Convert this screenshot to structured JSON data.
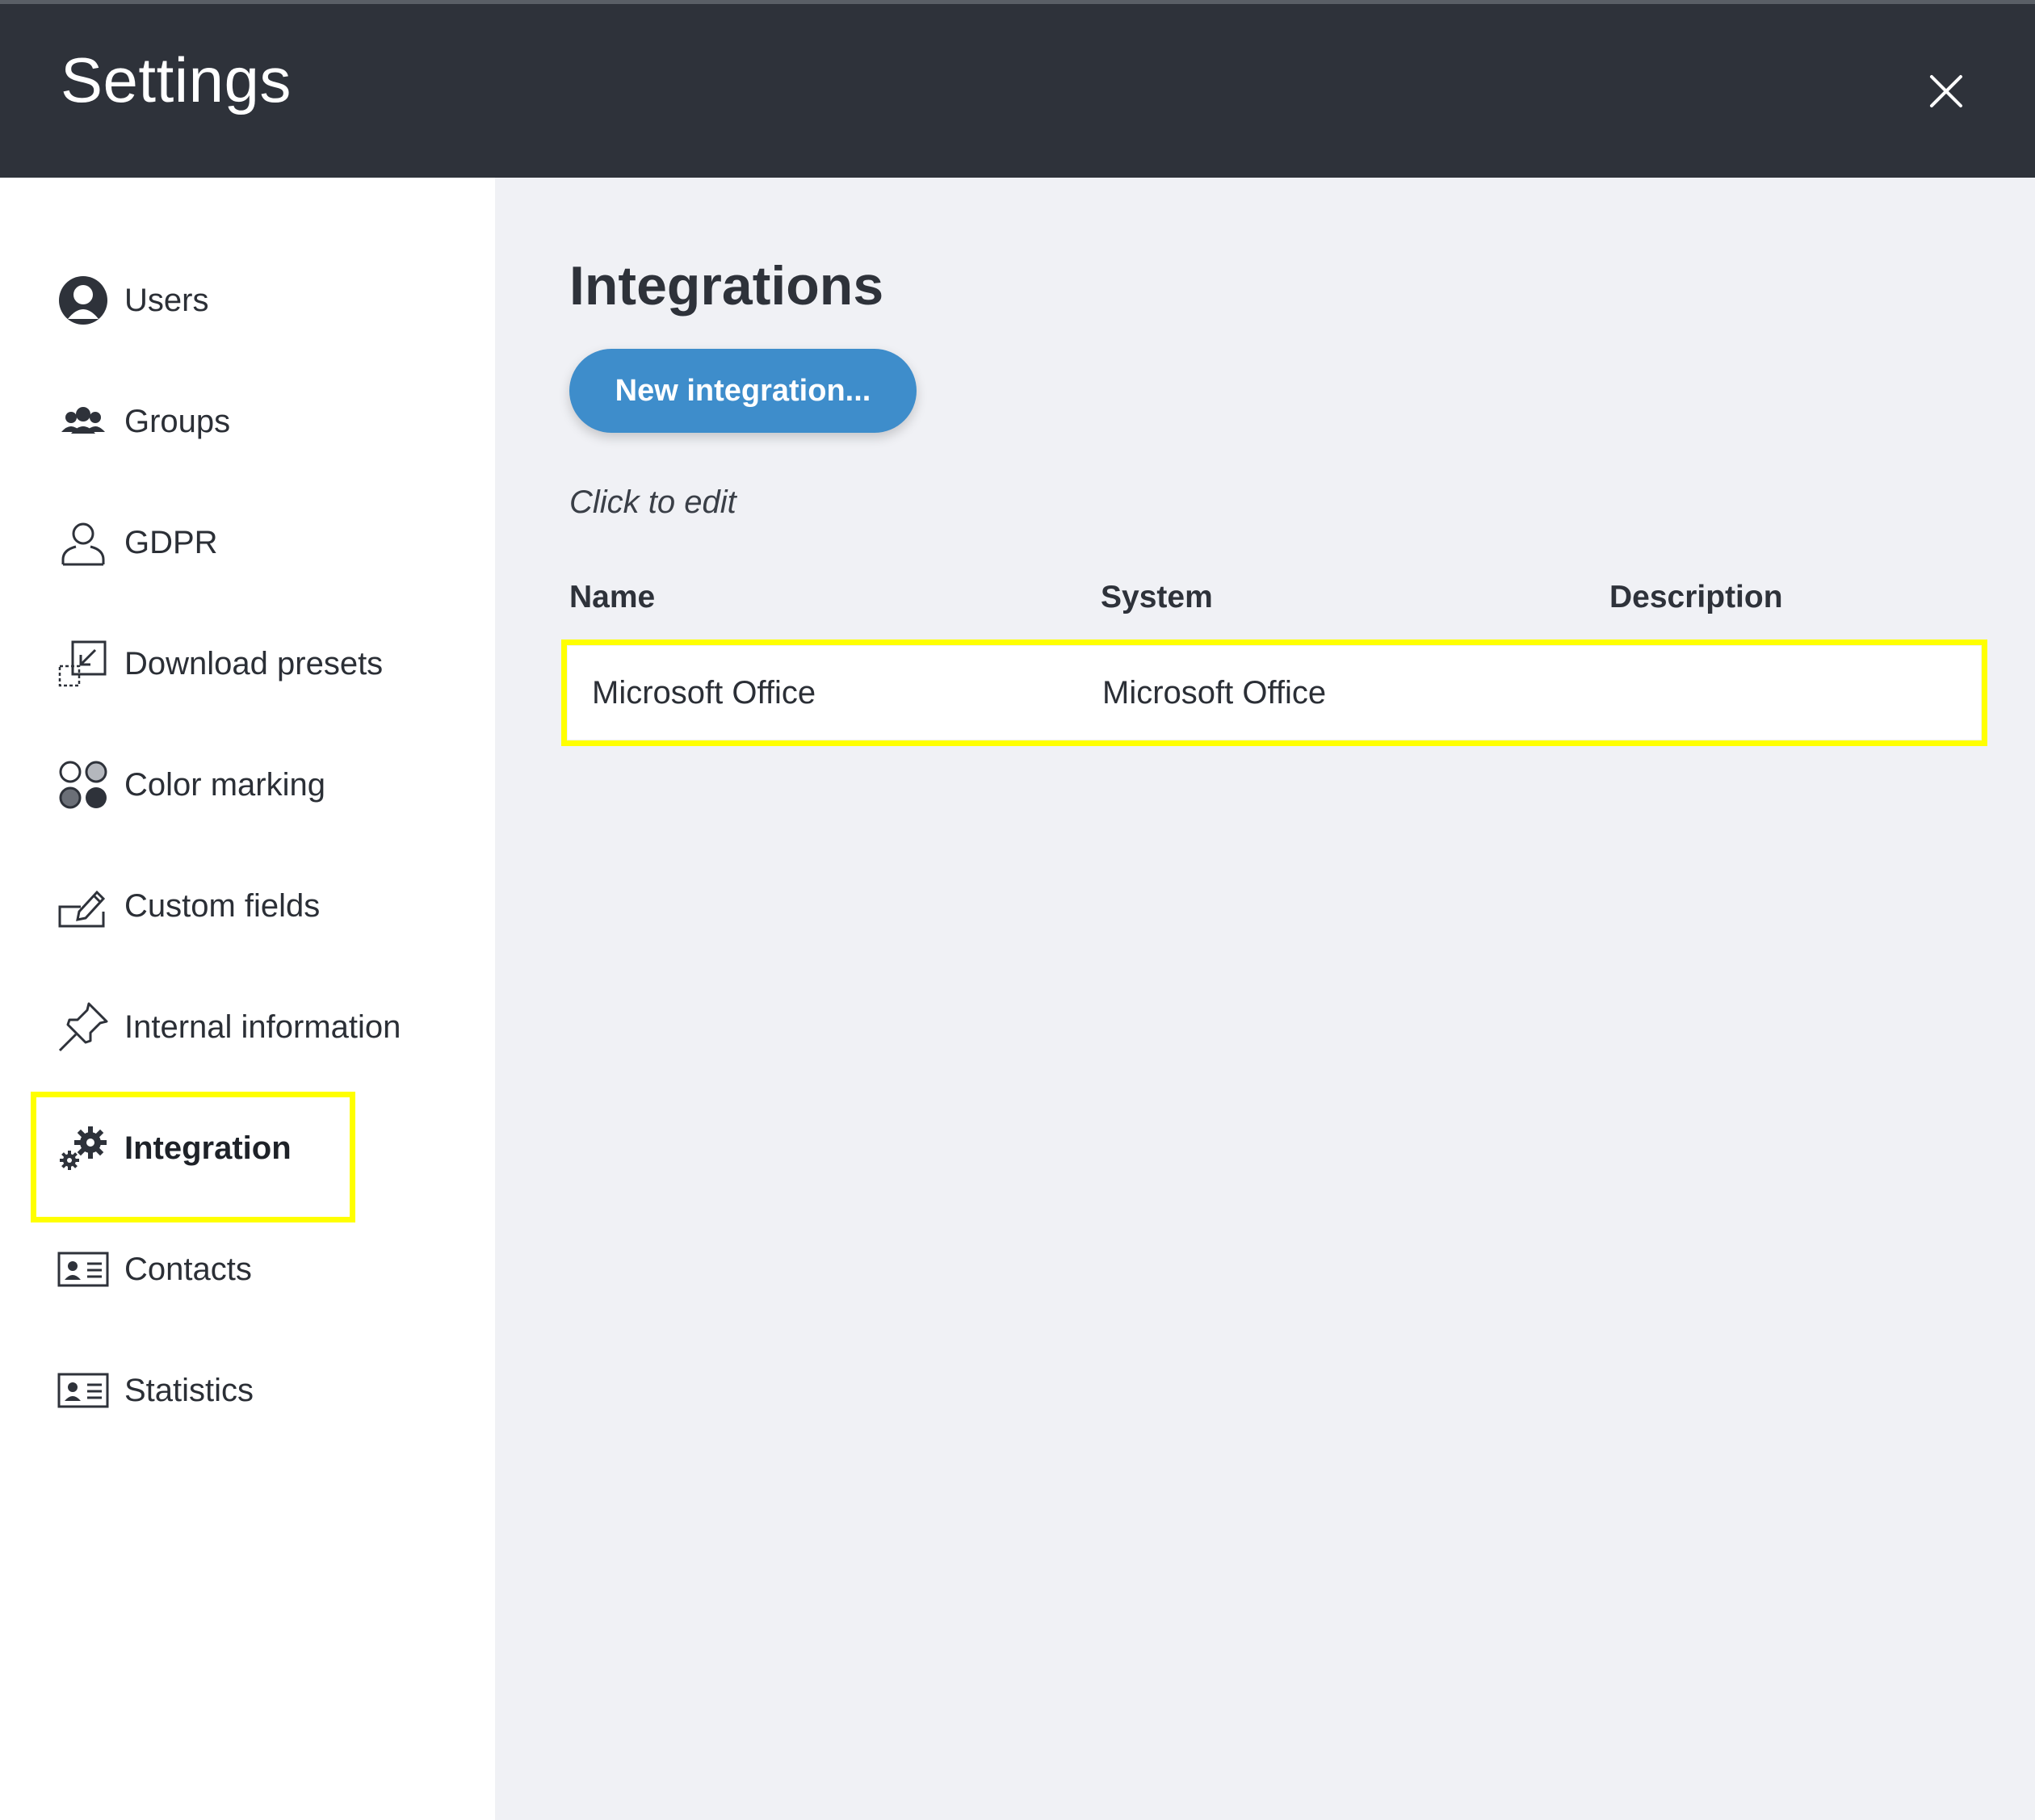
{
  "header": {
    "title": "Settings",
    "close_icon": "close-icon"
  },
  "sidebar": {
    "items": [
      {
        "label": "Users",
        "icon": "user-circle-icon"
      },
      {
        "label": "Groups",
        "icon": "group-icon"
      },
      {
        "label": "GDPR",
        "icon": "person-outline-icon"
      },
      {
        "label": "Download presets",
        "icon": "download-preset-icon"
      },
      {
        "label": "Color marking",
        "icon": "color-dots-icon"
      },
      {
        "label": "Custom fields",
        "icon": "edit-field-icon"
      },
      {
        "label": "Internal information",
        "icon": "pushpin-icon"
      },
      {
        "label": "Integration",
        "icon": "gears-icon",
        "active": true
      },
      {
        "label": "Contacts",
        "icon": "contact-card-icon"
      },
      {
        "label": "Statistics",
        "icon": "contact-card-icon"
      }
    ]
  },
  "main": {
    "title": "Integrations",
    "new_button_label": "New integration...",
    "hint": "Click to edit",
    "table": {
      "columns": [
        "Name",
        "System",
        "Description"
      ],
      "rows": [
        {
          "name": "Microsoft Office",
          "system": "Microsoft Office",
          "description": ""
        }
      ]
    }
  },
  "colors": {
    "header_bg": "#2e323a",
    "main_bg": "#f0f1f5",
    "accent": "#3e8dcb",
    "highlight": "#ffff00"
  }
}
